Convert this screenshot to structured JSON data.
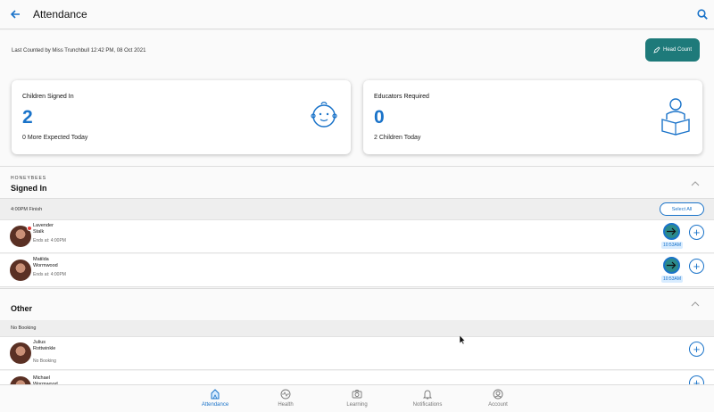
{
  "header": {
    "title": "Attendance",
    "back_icon": "back-arrow-icon",
    "search_icon": "search-icon"
  },
  "info": {
    "last_counted": "Last Counted by Miss Trunchbull  12:42 PM, 08 Oct 2021",
    "head_count_label": "Head Count"
  },
  "cards": [
    {
      "label": "Children Signed In",
      "value": "2",
      "sub": "0 More Expected Today",
      "icon": "baby-face-icon"
    },
    {
      "label": "Educators Required",
      "value": "0",
      "sub": "2 Children Today",
      "icon": "educator-reading-icon"
    }
  ],
  "signed_in": {
    "room": "HONEYBEES",
    "title": "Signed In",
    "group": "4:00PM Finish",
    "select_all": "Select All",
    "children": [
      {
        "first": "Lavender",
        "last": "Stalk",
        "ends": "Ends at: 4:00PM",
        "time": "10:53AM"
      },
      {
        "first": "Matilda",
        "last": "Wormwood",
        "ends": "Ends at: 4:00PM",
        "time": "10:53AM"
      }
    ]
  },
  "other": {
    "title": "Other",
    "group": "No Booking",
    "children": [
      {
        "first": "Julius",
        "last": "Rottwinkle",
        "status": "No Booking"
      },
      {
        "first": "Michael",
        "last": "Wormwood",
        "status": ""
      }
    ]
  },
  "tabs": [
    {
      "label": "Attendance",
      "icon": "attendance-icon",
      "active": true
    },
    {
      "label": "Health",
      "icon": "health-icon",
      "active": false
    },
    {
      "label": "Learning",
      "icon": "camera-icon",
      "active": false
    },
    {
      "label": "Notifications",
      "icon": "bell-icon",
      "active": false
    },
    {
      "label": "Account",
      "icon": "account-icon",
      "active": false
    }
  ],
  "colors": {
    "accent": "#1a73c9",
    "head_count_button": "#1e7a7a",
    "clock_button": "#2b8a8a",
    "badge": "#e53935"
  }
}
